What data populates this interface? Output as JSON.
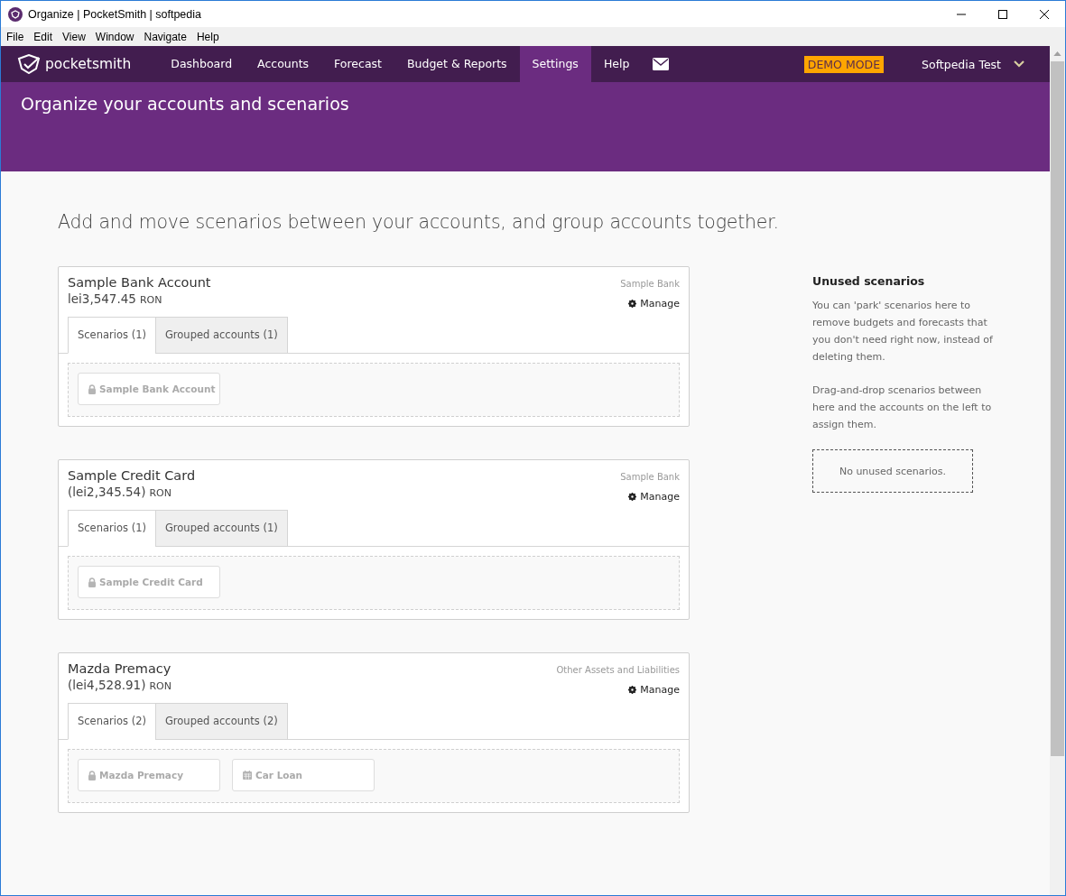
{
  "window": {
    "title": "Organize | PocketSmith | softpedia"
  },
  "menu": [
    "File",
    "Edit",
    "View",
    "Window",
    "Navigate",
    "Help"
  ],
  "nav": {
    "logo": "pocketsmith",
    "items": [
      {
        "label": "Dashboard",
        "selected": false
      },
      {
        "label": "Accounts",
        "selected": false
      },
      {
        "label": "Forecast",
        "selected": false
      },
      {
        "label": "Budget & Reports",
        "selected": false
      },
      {
        "label": "Settings",
        "selected": true
      },
      {
        "label": "Help",
        "selected": false
      }
    ],
    "badge": "DEMO MODE",
    "user": "Softpedia Test"
  },
  "header": {
    "title": "Organize your accounts and scenarios"
  },
  "intro": "Add and move scenarios between your accounts, and group accounts together.",
  "accounts": [
    {
      "name": "Sample Bank Account",
      "amount": "lei3,547.45",
      "currency": "RON",
      "institution": "Sample Bank",
      "manage": "Manage",
      "tabs": [
        {
          "label": "Scenarios (1)",
          "selected": true
        },
        {
          "label": "Grouped accounts (1)",
          "selected": false
        }
      ],
      "scenarios": [
        {
          "kind": "lock",
          "label": "Sample Bank Account"
        }
      ]
    },
    {
      "name": "Sample Credit Card",
      "amount": "(lei2,345.54)",
      "currency": "RON",
      "institution": "Sample Bank",
      "manage": "Manage",
      "tabs": [
        {
          "label": "Scenarios (1)",
          "selected": true
        },
        {
          "label": "Grouped accounts (1)",
          "selected": false
        }
      ],
      "scenarios": [
        {
          "kind": "lock",
          "label": "Sample Credit Card"
        }
      ]
    },
    {
      "name": "Mazda Premacy",
      "amount": "(lei4,528.91)",
      "currency": "RON",
      "institution": "Other Assets and Liabilities",
      "manage": "Manage",
      "tabs": [
        {
          "label": "Scenarios (2)",
          "selected": true
        },
        {
          "label": "Grouped accounts (2)",
          "selected": false
        }
      ],
      "scenarios": [
        {
          "kind": "lock",
          "label": "Mazda Premacy"
        },
        {
          "kind": "calendar",
          "label": "Car Loan"
        }
      ]
    }
  ],
  "unused": {
    "title": "Unused scenarios",
    "paragraphs": [
      "You can 'park' scenarios here to remove budgets and forecasts that you don't need right now, instead of deleting them.",
      "Drag-and-drop scenarios between here and the accounts on the left to assign them."
    ],
    "empty": "No unused scenarios."
  }
}
